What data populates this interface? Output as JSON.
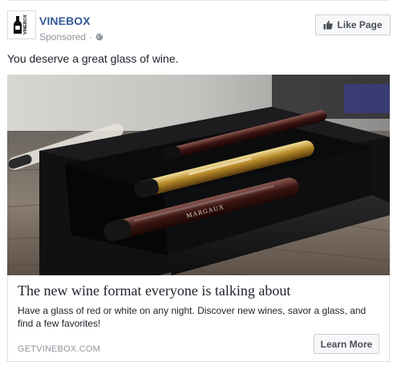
{
  "post": {
    "page_name": "VINEBOX",
    "sponsored_label": "Sponsored",
    "separator": "·",
    "privacy_icon": "globe-icon",
    "like_button_label": "Like Page",
    "like_icon": "thumbs-up-icon",
    "text": "You deserve a great glass of wine."
  },
  "logo": {
    "text": "VINEBOX",
    "icon": "wine-bottle-icon"
  },
  "ad_image": {
    "subject": "Open black box holding wine sample tubes on a wooden table",
    "tube_labels": [
      "MARGAUX"
    ]
  },
  "link_card": {
    "headline": "The new wine format everyone is talking about",
    "description": "Have a glass of red or white on any night. Discover new wines, savor a glass, and find a few favorites!",
    "domain": "GETVINEBOX.COM",
    "cta_label": "Learn More"
  },
  "colors": {
    "link_blue": "#365899",
    "meta_gray": "#90949c",
    "button_bg": "#f6f7f9",
    "border": "#dddfe2",
    "text": "#1d2129"
  }
}
